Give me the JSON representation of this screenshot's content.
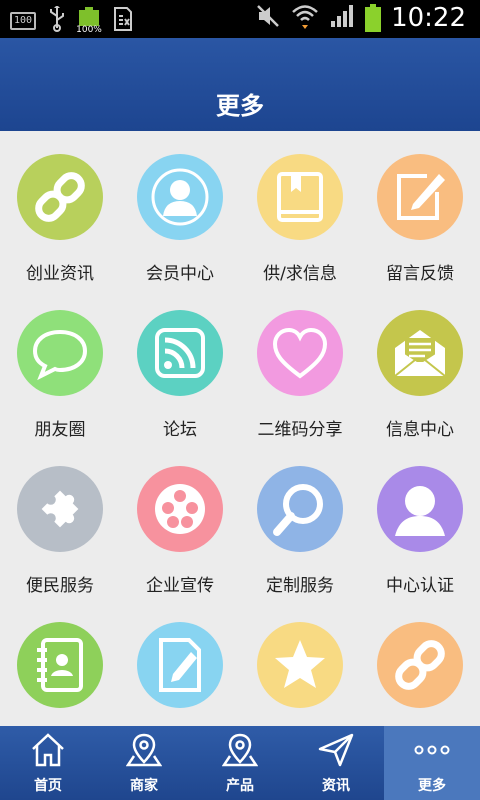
{
  "status_bar": {
    "left_badge": "100",
    "battery_small_pct": "100%",
    "time": "10:22"
  },
  "header": {
    "title": "更多"
  },
  "colors": {
    "header": "#1d4590",
    "nav_bar": "#2a56a4",
    "nav_active": "#4b78bd"
  },
  "grid": {
    "items": [
      {
        "label": "创业资讯",
        "icon": "chain-link-icon",
        "color": "#b8d05c"
      },
      {
        "label": "会员中心",
        "icon": "member-avatar-icon",
        "color": "#88d4f1"
      },
      {
        "label": "供/求信息",
        "icon": "book-icon",
        "color": "#f8da83"
      },
      {
        "label": "留言反馈",
        "icon": "edit-note-icon",
        "color": "#f9bd80"
      },
      {
        "label": "朋友圈",
        "icon": "chat-bubble-icon",
        "color": "#8fe07a"
      },
      {
        "label": "论坛",
        "icon": "rss-icon",
        "color": "#5cd1c2"
      },
      {
        "label": "二维码分享",
        "icon": "heart-icon",
        "color": "#f29ae0"
      },
      {
        "label": "信息中心",
        "icon": "mail-icon",
        "color": "#c4c64c"
      },
      {
        "label": "便民服务",
        "icon": "puzzle-icon",
        "color": "#b7bec7"
      },
      {
        "label": "企业宣传",
        "icon": "film-reel-icon",
        "color": "#f7929e"
      },
      {
        "label": "定制服务",
        "icon": "search-icon",
        "color": "#8fb4e6"
      },
      {
        "label": "中心认证",
        "icon": "user-icon",
        "color": "#a98ae8"
      },
      {
        "label": "",
        "icon": "contacts-icon",
        "color": "#8ed05a"
      },
      {
        "label": "",
        "icon": "document-edit-icon",
        "color": "#88d4f1"
      },
      {
        "label": "",
        "icon": "star-icon",
        "color": "#f8da83"
      },
      {
        "label": "",
        "icon": "chain-link-icon",
        "color": "#f9bd80"
      }
    ]
  },
  "bottom_nav": {
    "items": [
      {
        "label": "首页",
        "icon": "home-icon"
      },
      {
        "label": "商家",
        "icon": "map-pin-icon"
      },
      {
        "label": "产品",
        "icon": "map-pin-icon"
      },
      {
        "label": "资讯",
        "icon": "send-icon"
      },
      {
        "label": "更多",
        "icon": "more-dots-icon",
        "active": true
      }
    ]
  }
}
